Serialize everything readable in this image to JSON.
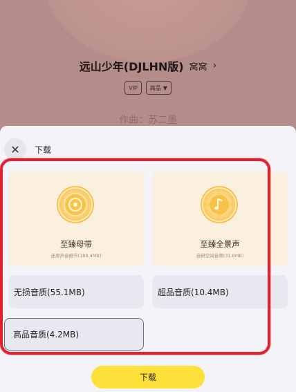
{
  "player": {
    "song_title": "远山少年(DJLHN版)",
    "artist": "窝窝",
    "artist_chevron": "›",
    "tags": [
      {
        "label": "VIP"
      },
      {
        "label": "高品",
        "has_dropdown": true
      }
    ],
    "lyric": "作曲：苏二墨"
  },
  "sheet": {
    "close_icon": "✕",
    "title": "下载",
    "premium_options": [
      {
        "label": "至臻母带",
        "sub": "还原声音细节(188.4MB)",
        "icon": "vinyl-disc-icon"
      },
      {
        "label": "至臻全景声",
        "sub": "自研空间音频(31.8MB)",
        "icon": "music-note-icon"
      }
    ],
    "quality_options": [
      {
        "label": "无损音质(55.1MB)",
        "selected": false
      },
      {
        "label": "超品音质(10.4MB)",
        "selected": false
      },
      {
        "label": "高品音质(4.2MB)",
        "selected": true
      }
    ],
    "download_label": "下载"
  },
  "colors": {
    "highlight_frame": "#e0222e",
    "download_button": "#fde13a",
    "premium_card": "#fbf0df",
    "medal_gold": "#f4c14e"
  }
}
